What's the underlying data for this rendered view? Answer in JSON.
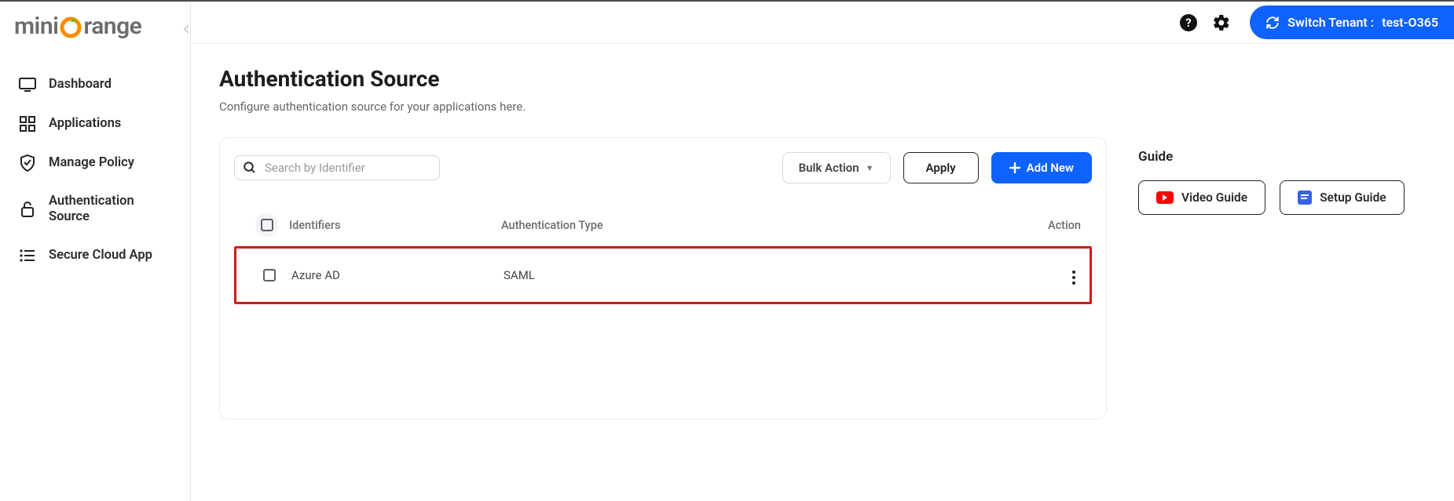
{
  "brand": {
    "prefix": "mini",
    "suffix": "range"
  },
  "sidebar": {
    "items": [
      {
        "label": "Dashboard"
      },
      {
        "label": "Applications"
      },
      {
        "label": "Manage Policy"
      },
      {
        "label": "Authentication Source"
      },
      {
        "label": "Secure Cloud App"
      }
    ]
  },
  "topbar": {
    "switch_label": "Switch Tenant :",
    "tenant_name": "test-O365"
  },
  "page": {
    "title": "Authentication Source",
    "subtitle": "Configure authentication source for your applications here."
  },
  "toolbar": {
    "search_placeholder": "Search by Identifier",
    "bulk_label": "Bulk Action",
    "apply_label": "Apply",
    "add_new_label": "Add New"
  },
  "table": {
    "headers": {
      "identifier": "Identifiers",
      "type": "Authentication Type",
      "action": "Action"
    },
    "rows": [
      {
        "identifier": "Azure AD",
        "type": "SAML"
      }
    ]
  },
  "guide": {
    "title": "Guide",
    "video_label": "Video Guide",
    "setup_label": "Setup Guide"
  }
}
